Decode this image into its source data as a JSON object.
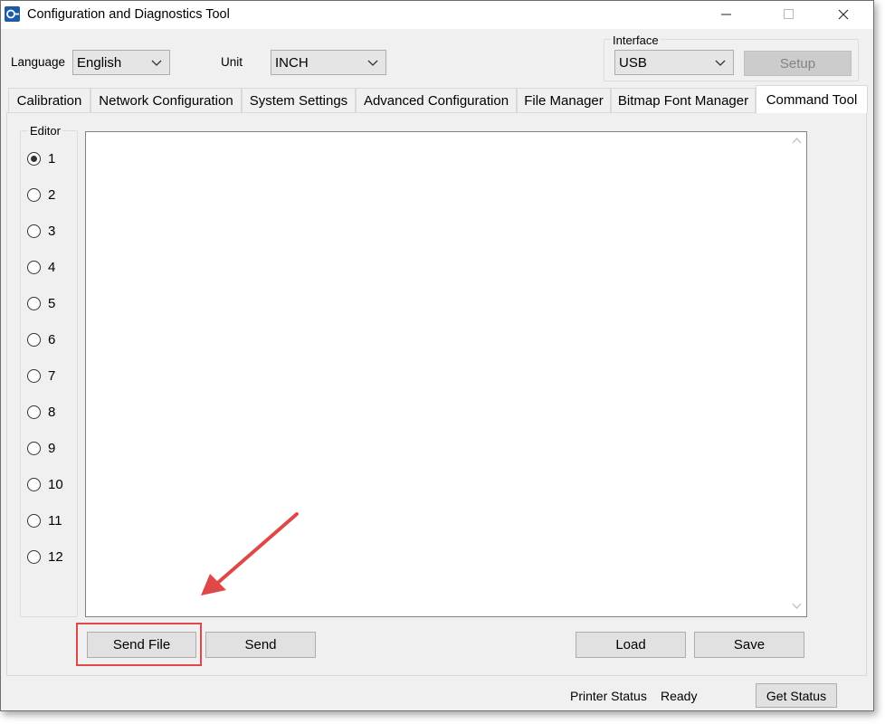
{
  "window": {
    "title": "Configuration and Diagnostics Tool",
    "icon": "app-logo-icon",
    "controls": [
      "minimize-icon",
      "maximize-icon",
      "close-icon"
    ]
  },
  "toolbar": {
    "language_label": "Language",
    "language_value": "English",
    "unit_label": "Unit",
    "unit_value": "INCH",
    "interface_group_label": "Interface",
    "interface_value": "USB",
    "setup_label": "Setup"
  },
  "tabs": [
    {
      "label": "Calibration",
      "active": false
    },
    {
      "label": "Network Configuration",
      "active": false
    },
    {
      "label": "System Settings",
      "active": false
    },
    {
      "label": "Advanced Configuration",
      "active": false
    },
    {
      "label": "File Manager",
      "active": false
    },
    {
      "label": "Bitmap Font Manager",
      "active": false
    },
    {
      "label": "Command Tool",
      "active": true
    }
  ],
  "editor_group": {
    "label": "Editor",
    "options": [
      "1",
      "2",
      "3",
      "4",
      "5",
      "6",
      "7",
      "8",
      "9",
      "10",
      "11",
      "12"
    ],
    "selected": "1"
  },
  "editor_area": {
    "content": ""
  },
  "actions": {
    "send_file": "Send File",
    "send": "Send",
    "load": "Load",
    "save": "Save"
  },
  "status_bar": {
    "printer_status_label": "Printer Status",
    "printer_status_value": "Ready",
    "get_status": "Get Status"
  },
  "annotation": {
    "highlight_color": "#e04848",
    "arrow_color": "#e04848",
    "target": "send-file-button"
  }
}
